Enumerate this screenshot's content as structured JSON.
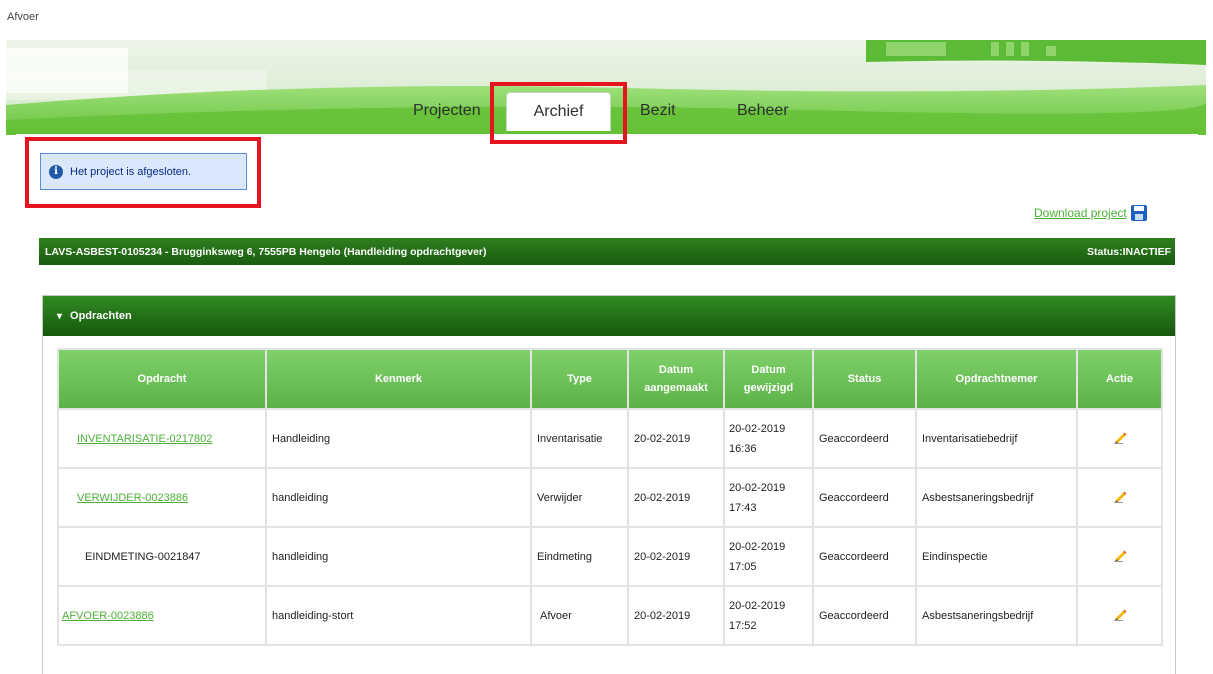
{
  "page_label": "Afvoer",
  "tabs": [
    {
      "label": "Projecten"
    },
    {
      "label": "Archief"
    },
    {
      "label": "Bezit"
    },
    {
      "label": "Beheer"
    }
  ],
  "info_message": "Het project is afgesloten.",
  "download_label": "Download project",
  "project": {
    "title": "LAVS-ASBEST-0105234 - Brugginksweg 6, 7555PB Hengelo (Handleiding opdrachtgever)",
    "status": "Status:INACTIEF"
  },
  "section_title": "Opdrachten",
  "table": {
    "headers": [
      "Opdracht",
      "Kenmerk",
      "Type",
      "Datum aangemaakt",
      "Datum gewijzigd",
      "Status",
      "Opdrachtnemer",
      "Actie"
    ],
    "header_date1_line1": "Datum",
    "header_date1_line2": "aangemaakt",
    "header_date2_line1": "Datum",
    "header_date2_line2": "gewijzigd",
    "rows": [
      {
        "opdracht": "INVENTARISATIE-0217802",
        "kenmerk": "Handleiding",
        "type": "Inventarisatie",
        "aangemaakt": "20-02-2019",
        "gewijzigd_date": "20-02-2019",
        "gewijzigd_time": "16:36",
        "status": "Geaccordeerd",
        "opdrachtnemer": "Inventarisatiebedrijf"
      },
      {
        "opdracht": "VERWIJDER-0023886",
        "kenmerk": "handleiding",
        "type": "Verwijder",
        "aangemaakt": "20-02-2019",
        "gewijzigd_date": "20-02-2019",
        "gewijzigd_time": "17:43",
        "status": "Geaccordeerd",
        "opdrachtnemer": "Asbestsaneringsbedrijf"
      },
      {
        "opdracht": "EINDMETING-0021847",
        "kenmerk": "handleiding",
        "type": "Eindmeting",
        "aangemaakt": "20-02-2019",
        "gewijzigd_date": "20-02-2019",
        "gewijzigd_time": "17:05",
        "status": "Geaccordeerd",
        "opdrachtnemer": "Eindinspectie"
      },
      {
        "opdracht": "AFVOER-0023886",
        "kenmerk": "handleiding-stort",
        "type": "Afvoer",
        "aangemaakt": "20-02-2019",
        "gewijzigd_date": "20-02-2019",
        "gewijzigd_time": "17:52",
        "status": "Geaccordeerd",
        "opdrachtnemer": "Asbestsaneringsbedrijf"
      }
    ]
  },
  "icons": {
    "info": "info-icon",
    "download": "floppy-disk-icon",
    "edit": "pencil-icon",
    "collapse": "chevron-double-down-icon"
  },
  "colors": {
    "accent_green": "#4caf37",
    "dark_green": "#1a5c10",
    "highlight_red": "#e5141f",
    "info_blue": "#dbe8fb"
  }
}
